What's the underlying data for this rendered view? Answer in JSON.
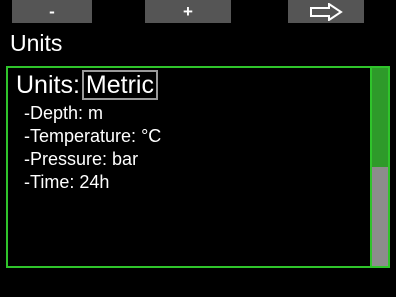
{
  "softkeys": {
    "left_label": "-",
    "middle_label": "+",
    "right_icon": "right-arrow-icon"
  },
  "header": {
    "title": "Units"
  },
  "settings": {
    "units_label": "Units:",
    "units_value": "Metric",
    "items": [
      {
        "label": "-Depth:",
        "value": "m"
      },
      {
        "label": "-Temperature:",
        "value": "°C"
      },
      {
        "label": "-Pressure:",
        "value": "bar"
      },
      {
        "label": "-Time:",
        "value": "24h"
      }
    ]
  },
  "colors": {
    "background": "#000000",
    "accent_green": "#2fc42b",
    "softkey_gray": "#555555",
    "scrollbar_track": "#8c8c8c",
    "scrollbar_thumb": "#2e9a2a"
  },
  "scrollbar": {
    "visible_fraction": 0.5,
    "position": 0
  }
}
